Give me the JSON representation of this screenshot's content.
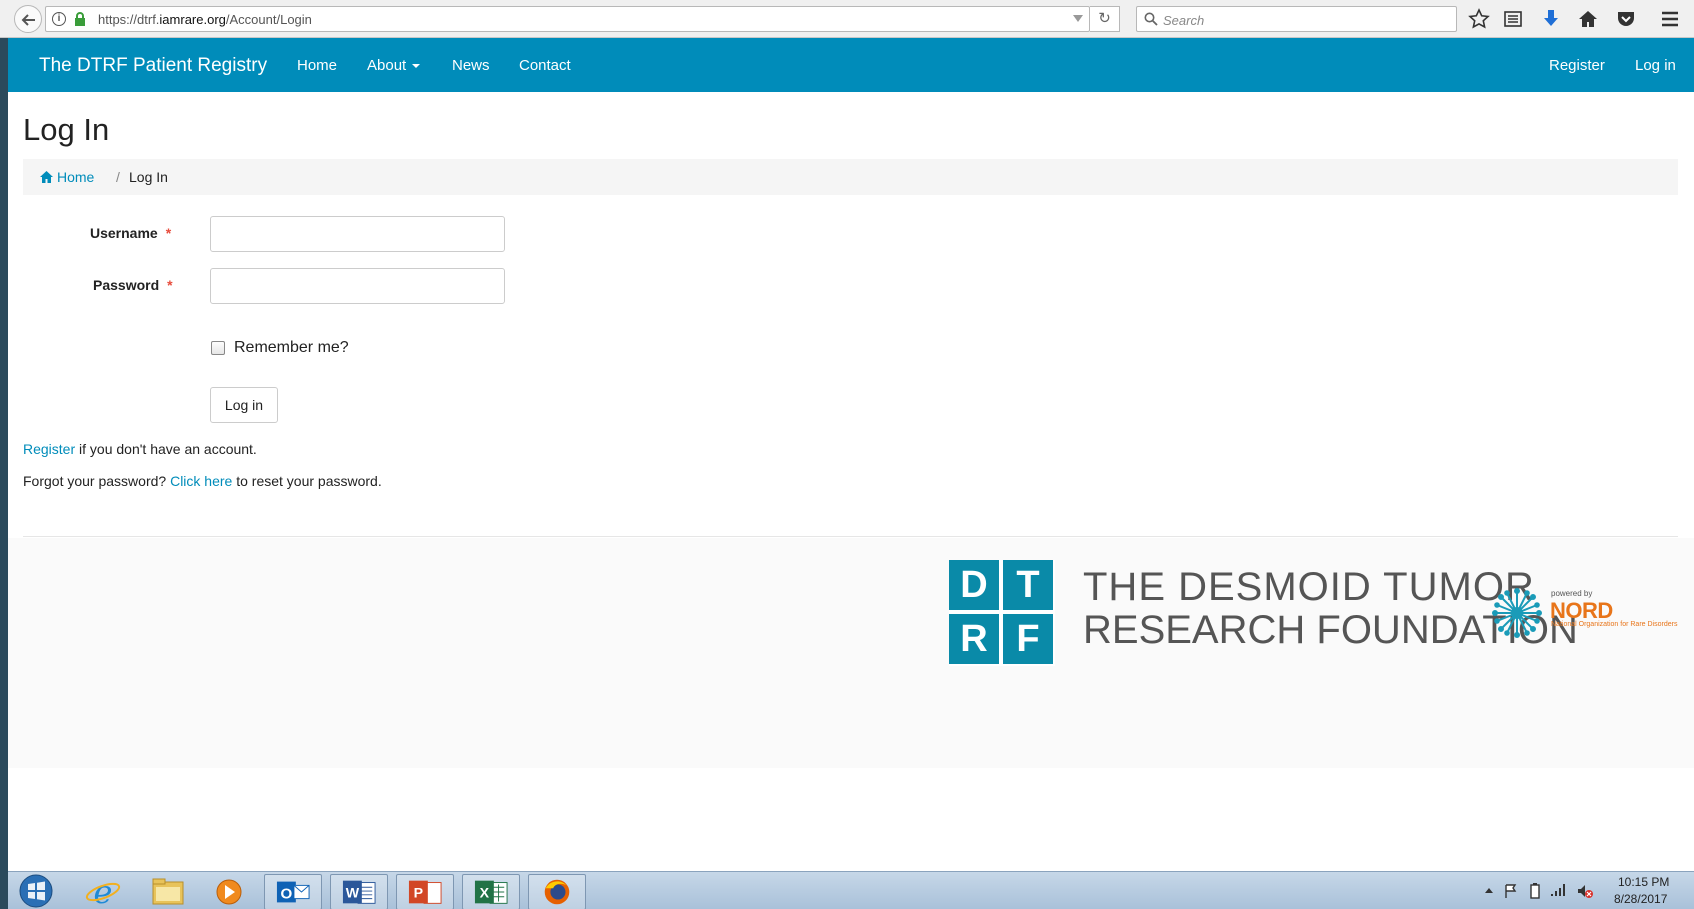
{
  "browser": {
    "url_prefix": "https://dtrf.",
    "url_domain": "iamrare.org",
    "url_path": "/Account/Login",
    "search_placeholder": "Search"
  },
  "navbar": {
    "brand": "The DTRF Patient Registry",
    "links": [
      "Home",
      "About",
      "News",
      "Contact"
    ],
    "right_links": [
      "Register",
      "Log in"
    ]
  },
  "page": {
    "title": "Log In",
    "breadcrumb": {
      "home": "Home",
      "separator": "/",
      "current": "Log In"
    },
    "form": {
      "username_label": "Username",
      "password_label": "Password",
      "required_mark": "*",
      "username_value": "",
      "password_value": "",
      "remember_label": "Remember me?",
      "remember_checked": false,
      "submit_label": "Log in"
    },
    "register_line": {
      "link": "Register",
      "text": " if you don't have an account."
    },
    "forgot_line": {
      "text_before": "Forgot your password? ",
      "link": "Click here",
      "text_after": " to reset your password."
    }
  },
  "footer": {
    "logo_letters": [
      "D",
      "T",
      "R",
      "F"
    ],
    "foundation_line1": "THE DESMOID TUMOR",
    "foundation_line2": "RESEARCH FOUNDATION",
    "nord_powered": "powered by",
    "nord_name": "NORD",
    "nord_subtitle": "National Organization for Rare Disorders"
  },
  "taskbar": {
    "apps": [
      "internet-explorer",
      "file-explorer",
      "media-player",
      "outlook",
      "word",
      "powerpoint",
      "excel",
      "firefox"
    ],
    "time": "10:15 PM",
    "date": "8/28/2017"
  },
  "colors": {
    "navbar": "#008cba",
    "link": "#008cba",
    "logo": "#0a8aa8",
    "nord": "#e8751a"
  }
}
